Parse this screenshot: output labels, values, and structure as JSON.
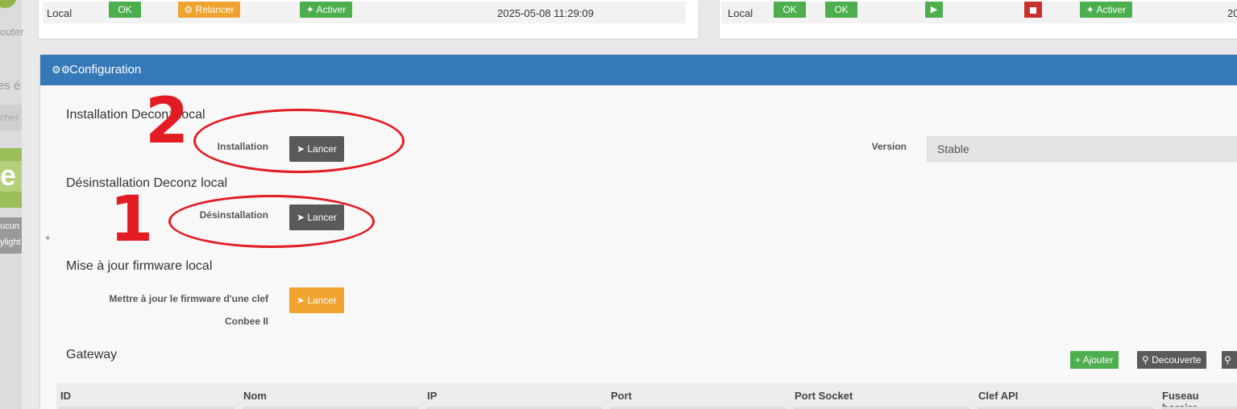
{
  "sidebar": {
    "fragments": [
      "outer",
      "es é",
      "cher",
      "ucun",
      "ylight"
    ],
    "logo_letter": "e"
  },
  "status_left": {
    "label": "Local",
    "ok": "OK",
    "restart": "Relancer",
    "activate": "Activer",
    "timestamp": "2025-05-08 11:29:09"
  },
  "status_right": {
    "label": "Local",
    "ok1": "OK",
    "ok2": "OK",
    "activate": "Activer",
    "date_fragment": "20"
  },
  "config": {
    "title": "Configuration",
    "install": {
      "title": "Installation Deconz local",
      "label": "Installation",
      "button": "Lancer"
    },
    "version": {
      "label": "Version",
      "value": "Stable"
    },
    "uninstall": {
      "title": "Désinstallation Deconz local",
      "label": "Désinstallation",
      "button": "Lancer"
    },
    "plus": "+",
    "firmware": {
      "title": "Mise à jour firmware local",
      "label_line1": "Mettre à jour le firmware d'une clef",
      "label_line2": "Conbee II",
      "button": "Lancer"
    },
    "gateway": {
      "title": "Gateway",
      "add": "Ajouter",
      "discover": "Decouverte",
      "columns": [
        "ID",
        "Nom",
        "IP",
        "Port",
        "Port Socket",
        "Clef API",
        "Fuseau horaire"
      ]
    }
  },
  "annotations": {
    "number_2": "2",
    "number_1": "1",
    "color": "#e31b23"
  },
  "colors": {
    "header": "#3579b8",
    "success": "#4cae4c",
    "warning": "#f0a32e",
    "danger": "#c9302c",
    "dark": "#5a5a5a"
  }
}
